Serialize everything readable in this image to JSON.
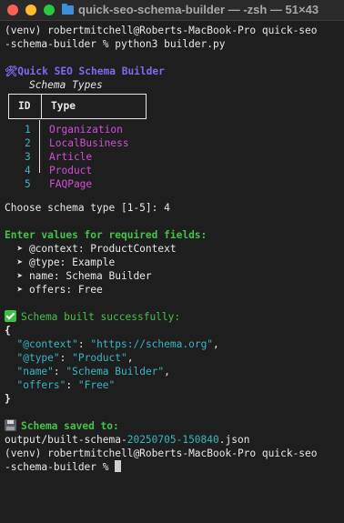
{
  "window": {
    "title": "quick-seo-schema-builder — -zsh — 51×43"
  },
  "terminal": {
    "cmd_line1": "(venv) robertmitchell@Roberts-MacBook-Pro quick-seo",
    "cmd_line2": "-schema-builder % python3 builder.py",
    "app_title_icon": "🛠",
    "app_title": "Quick SEO Schema Builder",
    "schema_types_heading": "Schema Types",
    "table": {
      "col_id": "ID",
      "col_type": "Type",
      "rows": [
        {
          "id": "1",
          "type": "Organization"
        },
        {
          "id": "2",
          "type": "LocalBusiness"
        },
        {
          "id": "3",
          "type": "Article"
        },
        {
          "id": "4",
          "type": "Product"
        },
        {
          "id": "5",
          "type": "FAQPage"
        }
      ]
    },
    "prompt_choose": "Choose schema type [1-5]: 4",
    "enter_values": "Enter values for required fields:",
    "fields": [
      "  ➤ @context: ProductContext",
      "  ➤ @type: Example",
      "  ➤ name: Schema Builder",
      "  ➤ offers: Free"
    ],
    "success_msg": "Schema built successfully:",
    "json_open": "{",
    "json_lines": [
      {
        "key": "\"@context\"",
        "value": "\"https://schema.org\"",
        "sep": ","
      },
      {
        "key": "\"@type\"",
        "value": "\"Product\"",
        "sep": ","
      },
      {
        "key": "\"name\"",
        "value": "\"Schema Builder\"",
        "sep": ","
      },
      {
        "key": "\"offers\"",
        "value": "\"Free\"",
        "sep": ""
      }
    ],
    "json_close": "}",
    "saved_msg": "Schema saved to:",
    "saved_path_prefix": "output/built-schema-",
    "saved_path_stamp": "20250705-150840",
    "saved_path_suffix": ".json",
    "prompt_line1": "(venv) robertmitchell@Roberts-MacBook-Pro quick-seo",
    "prompt_line2": "-schema-builder % "
  },
  "colors": {
    "purple": "#7d6bf2",
    "green": "#46c14a",
    "teal": "#37b6c3",
    "magenta": "#d24fd8"
  }
}
